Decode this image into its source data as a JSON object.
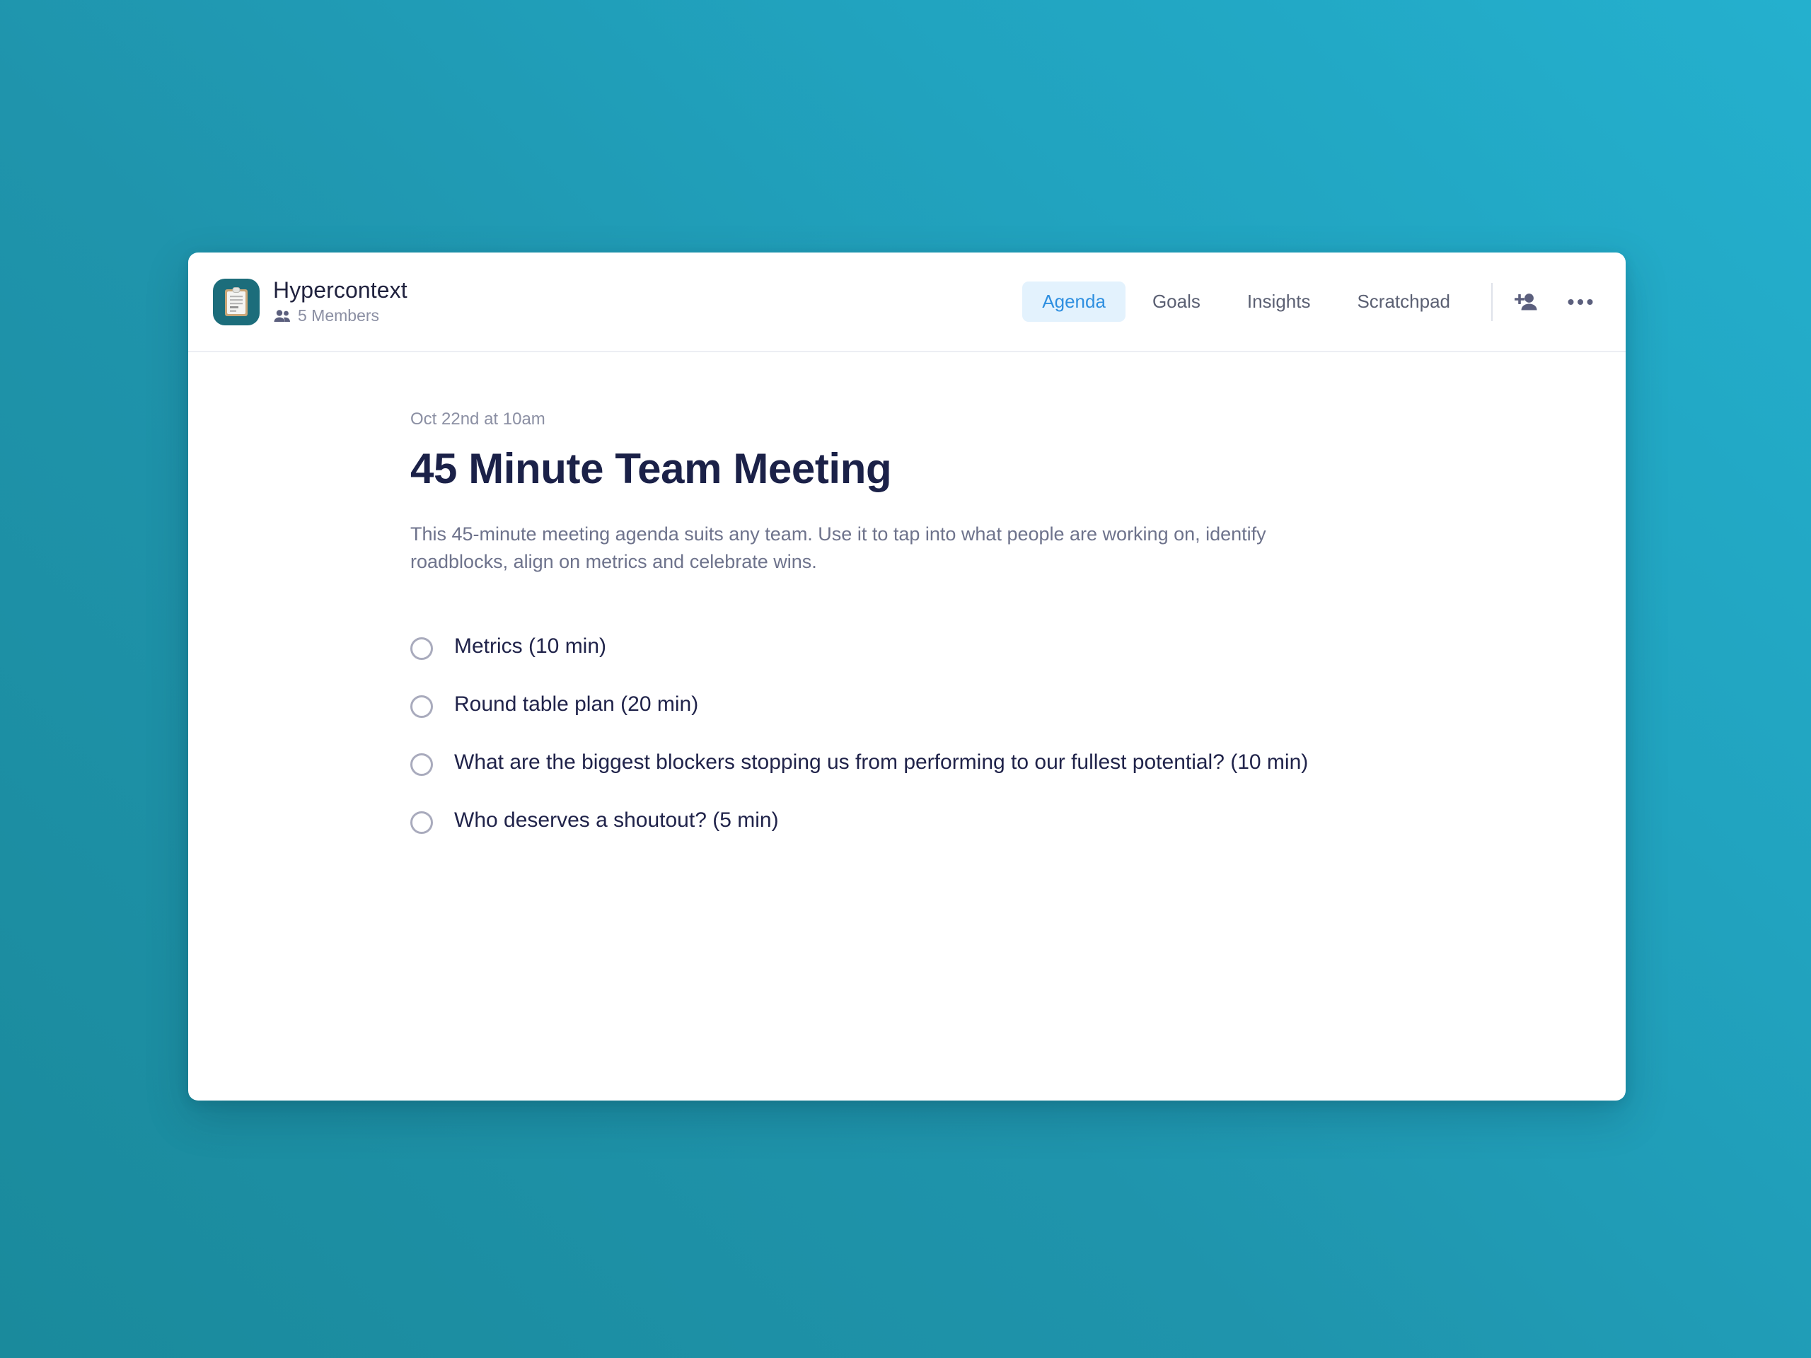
{
  "header": {
    "brand_name": "Hypercontext",
    "brand_icon": "clipboard-icon",
    "members_label": "5 Members",
    "members_icon": "people-icon",
    "tabs": [
      {
        "label": "Agenda",
        "active": true
      },
      {
        "label": "Goals",
        "active": false
      },
      {
        "label": "Insights",
        "active": false
      },
      {
        "label": "Scratchpad",
        "active": false
      }
    ],
    "actions": [
      {
        "name": "add-person-icon",
        "label": "Add member"
      },
      {
        "name": "more-options-icon",
        "label": "More options"
      }
    ]
  },
  "meeting": {
    "date": "Oct 22nd at 10am",
    "title": "45 Minute Team Meeting",
    "description": "This 45-minute meeting agenda suits any team. Use it to tap into what people are working on, identify roadblocks, align on metrics and celebrate wins.",
    "agenda_items": [
      {
        "label": "Metrics (10 min)",
        "checked": false
      },
      {
        "label": "Round table plan (20 min)",
        "checked": false
      },
      {
        "label": "What are the biggest blockers stopping us from performing to our fullest potential? (10 min)",
        "checked": false
      },
      {
        "label": "Who deserves a shoutout? (5 min)",
        "checked": false
      }
    ]
  },
  "colors": {
    "background_start": "#1a8a9c",
    "background_end": "#24b0ce",
    "card": "#ffffff",
    "active_tab_bg": "#e3f2fd",
    "active_tab_text": "#2e8fe0",
    "brand_icon_bg": "#1c6d7b",
    "title_text": "#1b2148",
    "muted_text": "#8b8fa3"
  }
}
